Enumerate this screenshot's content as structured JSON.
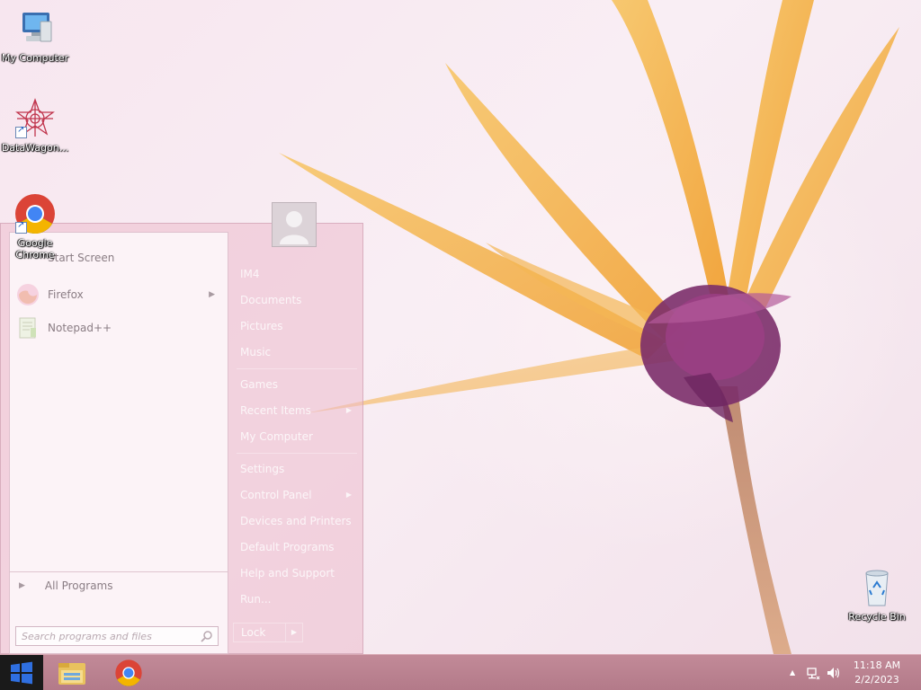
{
  "desktop": {
    "icons": [
      {
        "label": "My Computer"
      },
      {
        "label": "DataWagon..."
      },
      {
        "label": "Google Chrome"
      },
      {
        "label": "Recycle Bin"
      }
    ]
  },
  "start_menu": {
    "programs": [
      {
        "label": "Start Screen"
      },
      {
        "label": "Firefox"
      },
      {
        "label": "Notepad++"
      }
    ],
    "all_programs_label": "All Programs",
    "search": {
      "placeholder": "Search programs and files",
      "value": ""
    },
    "right_links": [
      {
        "label": "IM4"
      },
      {
        "label": "Documents"
      },
      {
        "label": "Pictures"
      },
      {
        "label": "Music"
      },
      {
        "label": "Games"
      },
      {
        "label": "Recent Items"
      },
      {
        "label": "My Computer"
      },
      {
        "label": "Settings"
      },
      {
        "label": "Control Panel"
      },
      {
        "label": "Devices and Printers"
      },
      {
        "label": "Default Programs"
      },
      {
        "label": "Help and Support"
      },
      {
        "label": "Run..."
      }
    ],
    "lock_label": "Lock"
  },
  "taskbar": {
    "apps": [
      "file-explorer-icon",
      "chrome-icon"
    ],
    "tray": {
      "time": "11:18 AM",
      "date": "2/2/2023"
    }
  },
  "colors": {
    "taskbar": "#b37a89",
    "start_button": "#1a1a1a",
    "windows_logo": "#2f6fe0"
  }
}
